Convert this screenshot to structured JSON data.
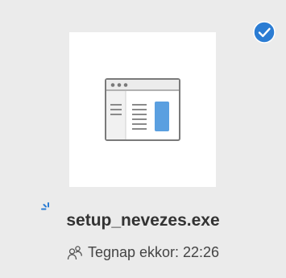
{
  "file": {
    "name": "setup_nevezes.exe",
    "modified": "Tegnap ekkor: 22:26",
    "selected": true,
    "icons": {
      "thumbnail": "application-window-icon",
      "selection": "checkmark-circle-icon",
      "sync_status": "syncing-icon",
      "sharing": "shared-people-icon"
    }
  },
  "colors": {
    "accent": "#2b7cd3",
    "tile_background": "#ebebeb",
    "thumbnail_background": "#ffffff"
  }
}
